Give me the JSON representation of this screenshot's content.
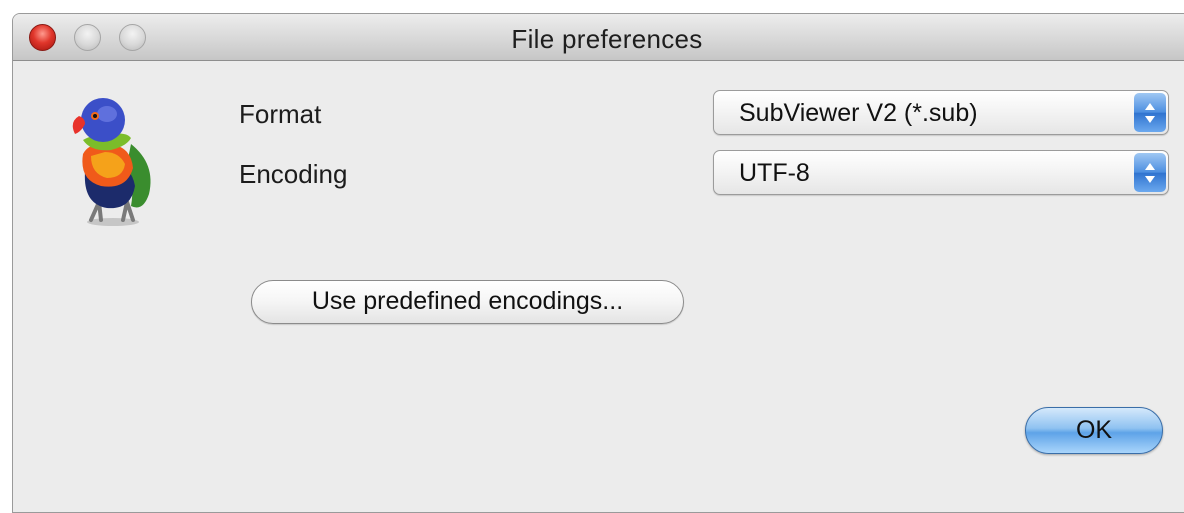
{
  "window": {
    "title": "File preferences"
  },
  "icon": "parrot-icon",
  "form": {
    "format_label": "Format",
    "format_value": "SubViewer V2  (*.sub)",
    "encoding_label": "Encoding",
    "encoding_value": "UTF-8"
  },
  "buttons": {
    "predefined_label": "Use predefined encodings...",
    "ok_label": "OK"
  },
  "colors": {
    "window_bg": "#ececec",
    "default_button": "#5ea3e8",
    "close_button": "#e0362b"
  }
}
